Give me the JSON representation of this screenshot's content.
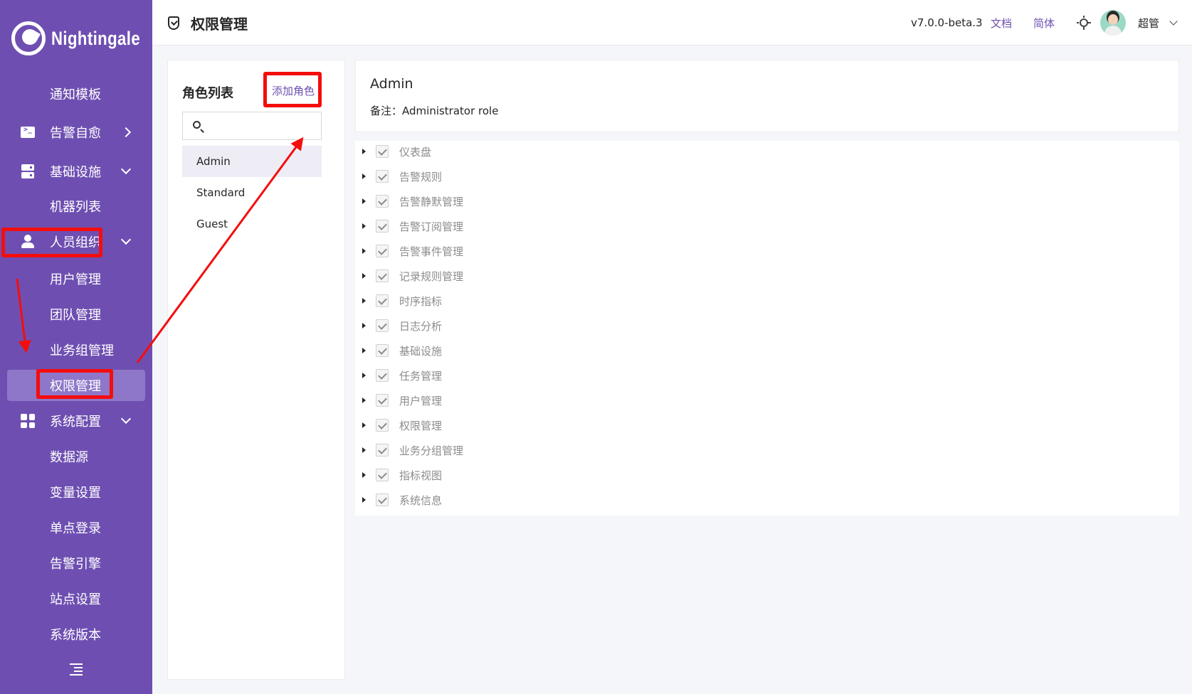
{
  "brand": {
    "name": "Nightingale"
  },
  "sidebar": {
    "items": [
      {
        "label": "通知模板"
      },
      {
        "label": "告警自愈",
        "icon": "terminal-icon"
      },
      {
        "label": "基础设施",
        "icon": "server-icon"
      },
      {
        "label": "机器列表"
      },
      {
        "label": "人员组织",
        "icon": "user-icon"
      },
      {
        "label": "用户管理"
      },
      {
        "label": "团队管理"
      },
      {
        "label": "业务组管理"
      },
      {
        "label": "权限管理",
        "active": true
      },
      {
        "label": "系统配置",
        "icon": "grid-icon"
      },
      {
        "label": "数据源"
      },
      {
        "label": "变量设置"
      },
      {
        "label": "单点登录"
      },
      {
        "label": "告警引擎"
      },
      {
        "label": "站点设置"
      },
      {
        "label": "系统版本"
      }
    ]
  },
  "header": {
    "title": "权限管理",
    "version": "v7.0.0-beta.3",
    "docs_label": "文档",
    "lang_label": "简体",
    "user_name": "超管"
  },
  "roles": {
    "title": "角色列表",
    "add_label": "添加角色",
    "search_placeholder": "",
    "items": [
      {
        "label": "Admin",
        "selected": true
      },
      {
        "label": "Standard"
      },
      {
        "label": "Guest"
      }
    ]
  },
  "detail": {
    "name": "Admin",
    "note_label": "备注：",
    "note_value": "Administrator role"
  },
  "permissions": [
    "仪表盘",
    "告警规则",
    "告警静默管理",
    "告警订阅管理",
    "告警事件管理",
    "记录规则管理",
    "时序指标",
    "日志分析",
    "基础设施",
    "任务管理",
    "用户管理",
    "权限管理",
    "业务分组管理",
    "指标视图",
    "系统信息"
  ],
  "colors": {
    "sidebar_bg": "#6e4fb1",
    "sidebar_active": "#8e77c8",
    "accent": "#6e4fb1",
    "annotation": "#f40d0d"
  }
}
